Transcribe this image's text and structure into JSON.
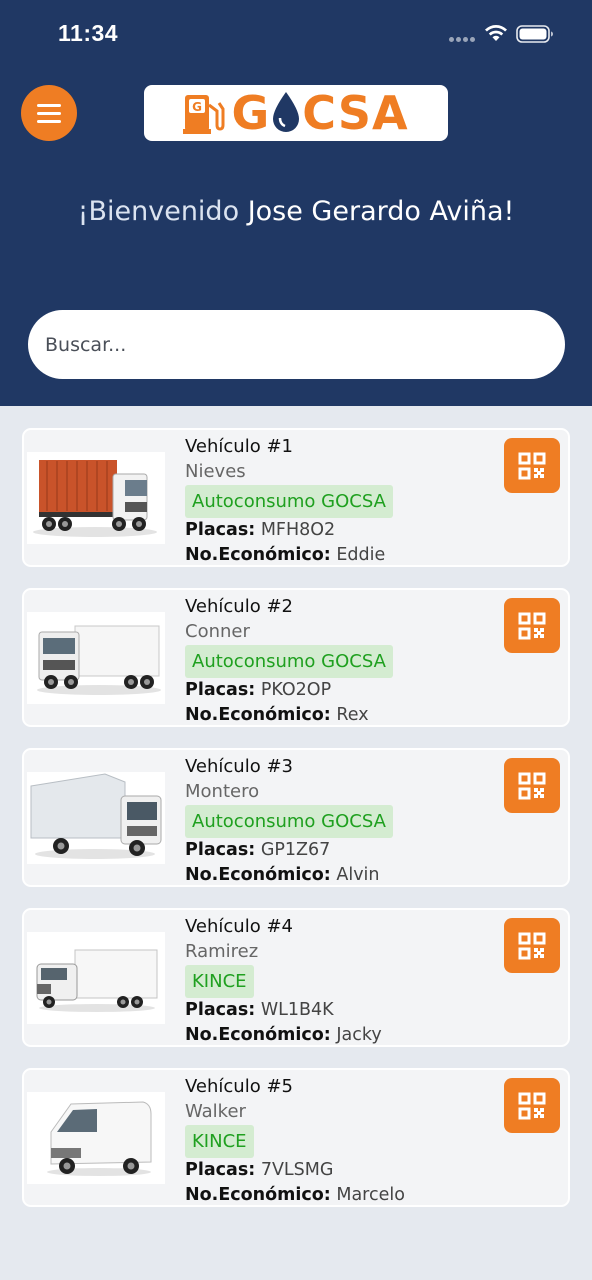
{
  "status_bar": {
    "time": "11:34"
  },
  "header": {
    "brand_text_1": "G",
    "brand_text_2": "CSA",
    "welcome_prefix": "¡Bienvenido",
    "welcome_name": "Jose Gerardo Aviña!",
    "accent_color": "#ef7d23",
    "bg_color": "#203864"
  },
  "search": {
    "placeholder": "Buscar..."
  },
  "vehicles": [
    {
      "title": "Vehículo #1",
      "owner": "Nieves",
      "badge": "Autoconsumo GOCSA",
      "plates_label": "Placas:",
      "plates": "MFH8O2",
      "eco_label": "No.Económico:",
      "eco": "Eddie",
      "image": "container-truck"
    },
    {
      "title": "Vehículo #2",
      "owner": "Conner",
      "badge": "Autoconsumo GOCSA",
      "plates_label": "Placas:",
      "plates": "PKO2OP",
      "eco_label": "No.Económico:",
      "eco": "Rex",
      "image": "semi-trailer-truck"
    },
    {
      "title": "Vehículo #3",
      "owner": "Montero",
      "badge": "Autoconsumo GOCSA",
      "plates_label": "Placas:",
      "plates": "GP1Z67",
      "eco_label": "No.Económico:",
      "eco": "Alvin",
      "image": "box-truck"
    },
    {
      "title": "Vehículo #4",
      "owner": "Ramirez",
      "badge": "KINCE",
      "plates_label": "Placas:",
      "plates": "WL1B4K",
      "eco_label": "No.Económico:",
      "eco": "Jacky",
      "image": "box-truck-small"
    },
    {
      "title": "Vehículo #5",
      "owner": "Walker",
      "badge": "KINCE",
      "plates_label": "Placas:",
      "plates": "7VLSMG",
      "eco_label": "No.Económico:",
      "eco": "Marcelo",
      "image": "cargo-van"
    }
  ]
}
